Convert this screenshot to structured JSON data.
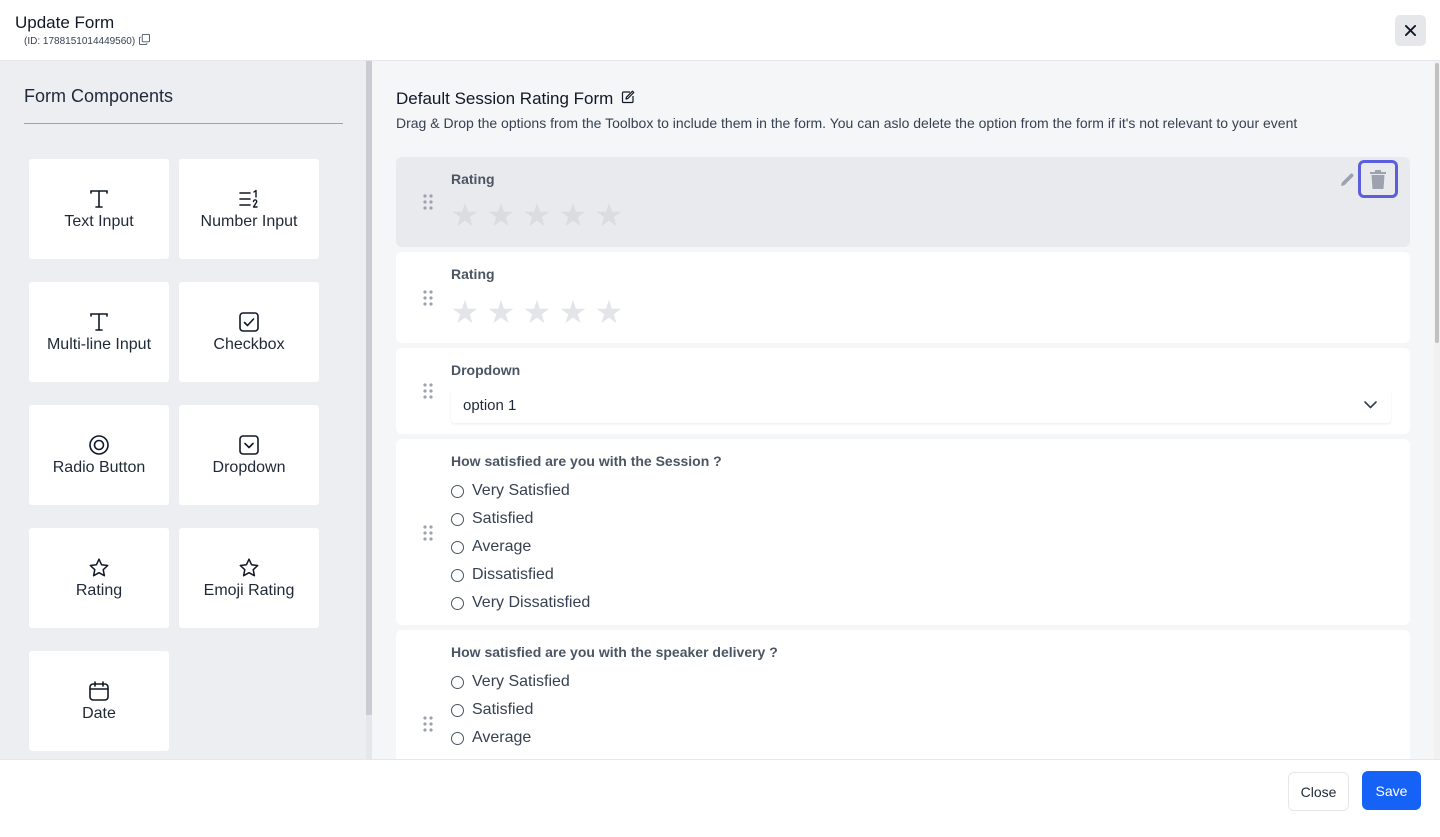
{
  "header": {
    "title": "Update Form",
    "id_text": "(ID: 1788151014449560)",
    "copy_icon": "copy-icon",
    "close_icon": "close-icon"
  },
  "sidebar": {
    "title": "Form Components",
    "components": [
      {
        "label": "Text Input",
        "icon": "text-icon"
      },
      {
        "label": "Number Input",
        "icon": "number-list-icon"
      },
      {
        "label": "Multi-line Input",
        "icon": "text-icon"
      },
      {
        "label": "Checkbox",
        "icon": "checkbox-icon"
      },
      {
        "label": "Radio Button",
        "icon": "radio-icon"
      },
      {
        "label": "Dropdown",
        "icon": "dropdown-icon"
      },
      {
        "label": "Rating",
        "icon": "star-icon"
      },
      {
        "label": "Emoji Rating",
        "icon": "star-icon"
      },
      {
        "label": "Date",
        "icon": "calendar-icon"
      }
    ]
  },
  "main": {
    "form_title": "Default Session Rating Form",
    "form_description": "Drag & Drop the options from the Toolbox to include them in the form. You can aslo delete the option from the form if it's not relevant to your event",
    "fields": [
      {
        "type": "rating",
        "label": "Rating",
        "stars": 5,
        "selected": true
      },
      {
        "type": "rating",
        "label": "Rating",
        "stars": 5
      },
      {
        "type": "dropdown",
        "label": "Dropdown",
        "value": "option 1"
      },
      {
        "type": "radio",
        "label": "How satisfied are you with the Session ?",
        "options": [
          "Very Satisfied",
          "Satisfied",
          "Average",
          "Dissatisfied",
          "Very Dissatisfied"
        ]
      },
      {
        "type": "radio",
        "label": "How satisfied are you with the speaker delivery ?",
        "options": [
          "Very Satisfied",
          "Satisfied",
          "Average"
        ]
      }
    ]
  },
  "footer": {
    "close_label": "Close",
    "save_label": "Save"
  },
  "colors": {
    "primary": "#1662f6",
    "focus_ring": "#5b5fde",
    "sidebar_bg": "#eceef2"
  }
}
